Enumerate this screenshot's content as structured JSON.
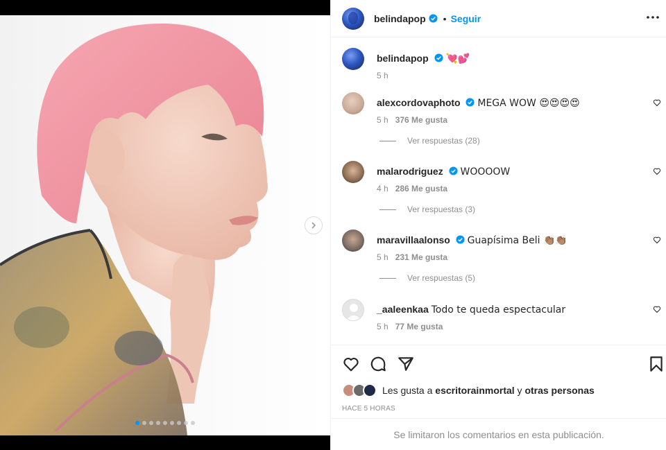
{
  "post": {
    "username": "belindapop",
    "follow_label": "Seguir",
    "separator": "•",
    "caption_emoji": "💘💕",
    "caption_time": "5 h",
    "carousel": {
      "total_slides": 9,
      "active_slide": 1
    }
  },
  "comments": [
    {
      "username": "alexcordovaphoto",
      "verified": true,
      "text": "MEGA WOW 😍😍😍😍",
      "time": "5 h",
      "likes": "376 Me gusta",
      "replies": "Ver respuestas (28)"
    },
    {
      "username": "malarodriguez",
      "verified": true,
      "text": "WOOOOW",
      "time": "4 h",
      "likes": "286 Me gusta",
      "replies": "Ver respuestas (3)"
    },
    {
      "username": "maravillaalonso",
      "verified": true,
      "text": "Guapísima Beli 👏🏽👏🏽",
      "time": "5 h",
      "likes": "231 Me gusta",
      "replies": "Ver respuestas (5)"
    },
    {
      "username": "_aaleenkaa",
      "verified": false,
      "text": "Todo te queda espectacular",
      "time": "5 h",
      "likes": "77 Me gusta"
    }
  ],
  "likes_summary": {
    "prefix": "Les gusta a",
    "user": "escritorainmortal",
    "joiner": "y",
    "others": "otras personas"
  },
  "timestamp": "HACE 5 HORAS",
  "comments_limited": "Se limitaron los comentarios en esta publicación.",
  "colors": {
    "accent": "#0095f6",
    "text": "#262626",
    "muted": "#8e8e8e",
    "hair": "#f09aa6"
  },
  "icons": [
    "more-options-icon",
    "verified-badge-icon",
    "heart-icon",
    "comment-icon",
    "share-icon",
    "bookmark-icon",
    "chevron-right-icon"
  ]
}
